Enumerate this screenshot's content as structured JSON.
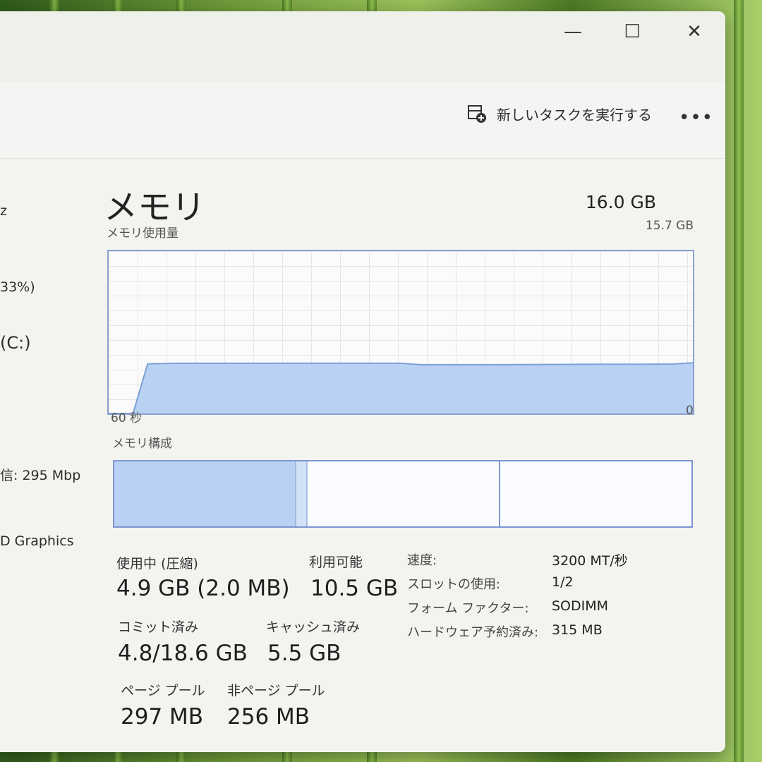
{
  "window": {
    "controls": {
      "minimize_icon": "minimize-icon",
      "maximize_icon": "maximize-icon",
      "close_icon": "close-icon"
    }
  },
  "toolbar": {
    "new_task_label": "新しいタスクを実行する",
    "more_label": "•••"
  },
  "sidebar": {
    "fragments": [
      "z",
      "33%)",
      "(C:)",
      "信: 295 Mbp",
      "D Graphics"
    ]
  },
  "memory": {
    "title": "メモリ",
    "total": "16.0 GB",
    "usage_label": "メモリ使用量",
    "usage_max": "15.7 GB",
    "axis_left": "60 秒",
    "axis_right": "0",
    "composition_label": "メモリ構成"
  },
  "stats": {
    "in_use_label": "使用中 (圧縮)",
    "in_use_value": "4.9 GB (2.0 MB)",
    "available_label": "利用可能",
    "available_value": "10.5 GB",
    "committed_label": "コミット済み",
    "committed_value": "4.8/18.6 GB",
    "cached_label": "キャッシュ済み",
    "cached_value": "5.5 GB",
    "paged_pool_label": "ページ プール",
    "paged_pool_value": "297 MB",
    "nonpaged_pool_label": "非ページ プール",
    "nonpaged_pool_value": "256 MB"
  },
  "properties": [
    {
      "key": "速度:",
      "value": "3200 MT/秒"
    },
    {
      "key": "スロットの使用:",
      "value": "1/2"
    },
    {
      "key": "フォーム ファクター:",
      "value": "SODIMM"
    },
    {
      "key": "ハードウェア予約済み:",
      "value": "315 MB"
    }
  ],
  "chart_data": {
    "type": "area",
    "x": [
      60,
      57.5,
      56,
      53,
      50,
      46,
      40,
      35,
      30,
      28,
      25,
      20,
      15,
      10,
      5,
      2,
      0
    ],
    "values": [
      0,
      0,
      4.8,
      4.85,
      4.85,
      4.85,
      4.87,
      4.87,
      4.85,
      4.72,
      4.72,
      4.72,
      4.74,
      4.76,
      4.76,
      4.78,
      4.9
    ],
    "xlim": [
      60,
      0
    ],
    "ylim": [
      0,
      15.7
    ],
    "grid": true,
    "color": "#b9d2f3",
    "line_color": "#7ca0d8"
  },
  "composition": {
    "in_use_fraction": 0.313,
    "modified_fraction": 0.02,
    "standby_fraction": 0.333,
    "color": "#b9d2f3"
  }
}
